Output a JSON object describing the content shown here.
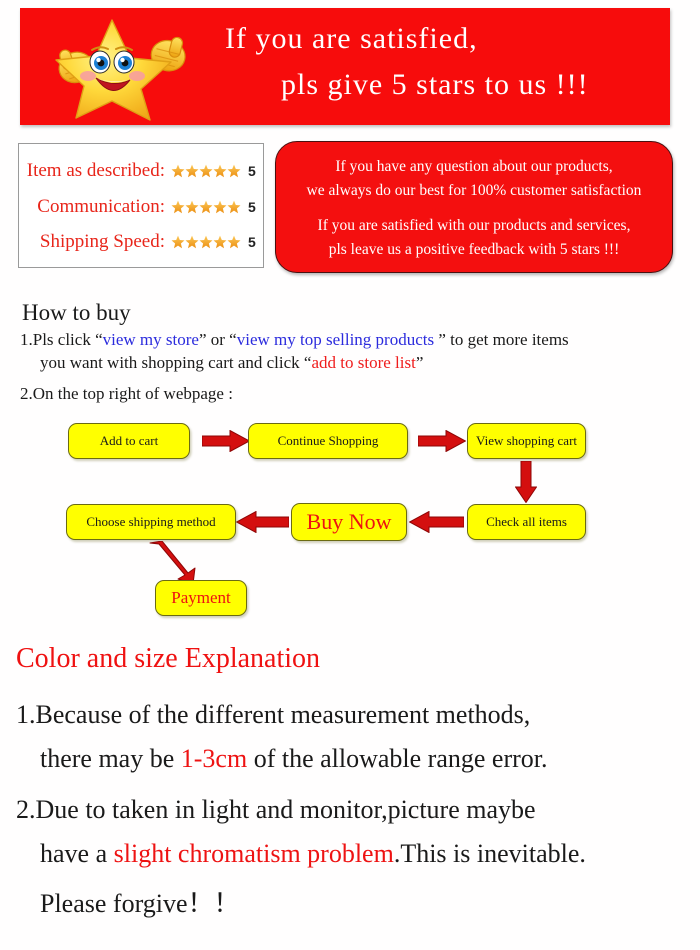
{
  "banner": {
    "line1": "If you are satisfied,",
    "line2": "pls give 5 stars to us !!!",
    "bg_color": "#f70c0c",
    "text_color": "#ffffff",
    "mascot": "smiling-star-thumbs-up"
  },
  "ratings": {
    "rows": [
      {
        "label": "Item as described:",
        "stars": 5,
        "score": "5"
      },
      {
        "label": "Communication:",
        "stars": 5,
        "score": "5"
      },
      {
        "label": "Shipping Speed:",
        "stars": 5,
        "score": "5"
      }
    ],
    "label_color": "#e8251a",
    "star_color": "#f5a623"
  },
  "feedback": {
    "lines": [
      "If you have any question about our products,",
      "we always do our best for 100% customer satisfaction",
      "If you are satisfied with our products and services,",
      "pls leave us a positive feedback with 5 stars !!!"
    ],
    "bg_color": "#f40f0f",
    "text_color": "#ffffff"
  },
  "howto": {
    "title": "How to buy",
    "line1_pre": "1.Pls click “",
    "line1_link1": "view my store",
    "line1_mid": "” or “",
    "line1_link2": "view my top selling products",
    "line1_post": " ” to get more items",
    "line2_pre": "you want with shopping cart and click “",
    "line2_red": "add to store list",
    "line2_post": "”",
    "line3": "2.On the top right of webpage :",
    "link_color": "#2b2bdd",
    "highlight_color": "#ef1c1c"
  },
  "flowchart": {
    "box_bg": "#ffff00",
    "box_border": "#6b6b12",
    "arrow_color": "#d40f0f",
    "steps": [
      {
        "label": "Add to cart",
        "style": "black"
      },
      {
        "label": "Continue Shopping",
        "style": "black"
      },
      {
        "label": "View shopping cart",
        "style": "black"
      },
      {
        "label": "Check all items",
        "style": "black"
      },
      {
        "label": "Buy Now",
        "style": "red-large"
      },
      {
        "label": "Choose shipping method",
        "style": "black"
      },
      {
        "label": "Payment",
        "style": "red"
      }
    ]
  },
  "explanation": {
    "title": "Color and size Explanation",
    "item1_line1": "1.Because of the different measurement methods,",
    "item1_line2_pre": "there may be ",
    "item1_line2_red": "1-3cm",
    "item1_line2_post": " of the allowable range error.",
    "item2_line1": "2.Due to taken in light and monitor,picture maybe",
    "item2_line2_pre": "have a ",
    "item2_line2_red": "slight chromatism problem",
    "item2_line2_post": ".This is inevitable.",
    "item2_line3_pre": "Please forgive",
    "item2_line3_marks": "！！",
    "title_color": "#ef1111"
  }
}
